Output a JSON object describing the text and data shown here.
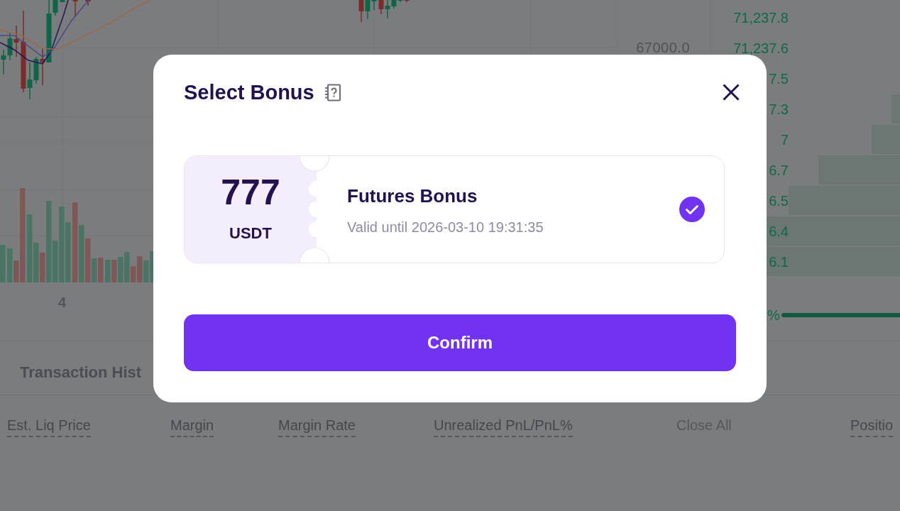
{
  "chart": {
    "x_axis_label": "4",
    "price_label": "67000.0"
  },
  "order_book": {
    "rows": [
      {
        "price": "71,237.8"
      },
      {
        "price": "71,237.6"
      },
      {
        "price": "7.5"
      },
      {
        "price": "7.3"
      },
      {
        "price": "7"
      },
      {
        "price": "6.7"
      },
      {
        "price": "6.5"
      },
      {
        "price": "6.4"
      },
      {
        "price": "6.1"
      }
    ],
    "ratio_label": "%"
  },
  "history_panel": {
    "tab": "Transaction Hist",
    "columns": [
      {
        "label": "Est. Liq Price",
        "kind": "term"
      },
      {
        "label": "Margin",
        "kind": "term"
      },
      {
        "label": "Margin Rate",
        "kind": "term"
      },
      {
        "label": "Unrealized PnL/PnL%",
        "kind": "term"
      },
      {
        "label": "Close All",
        "kind": "action"
      },
      {
        "label": "Positio",
        "kind": "term"
      }
    ]
  },
  "dialog": {
    "title": "Select Bonus",
    "bonuses": [
      {
        "amount": "777",
        "currency": "USDT",
        "title": "Futures Bonus",
        "validity": "Valid until 2026-03-10 19:31:35",
        "selected": true
      }
    ],
    "confirm_label": "Confirm"
  }
}
